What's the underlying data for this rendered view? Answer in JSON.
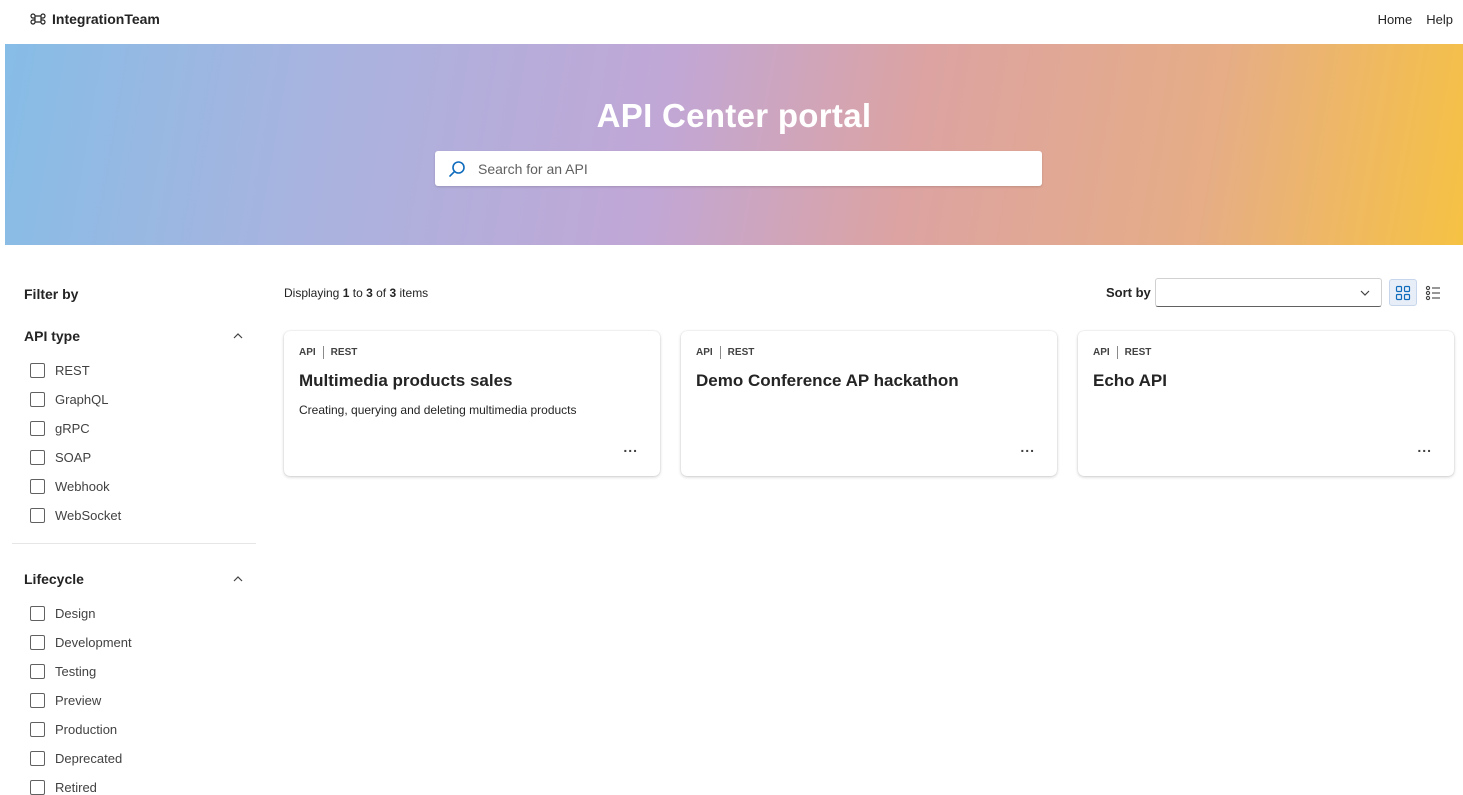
{
  "nav": {
    "brand": "IntegrationTeam",
    "brand_icon": "command-key-icon",
    "links": [
      "Home",
      "Help"
    ]
  },
  "hero": {
    "title": "API Center portal",
    "search_placeholder": "Search for an API",
    "search_icon": "search-icon",
    "gradient_colors": [
      "#86bde6",
      "#c1a7d6",
      "#dca3a2",
      "#f6c243"
    ]
  },
  "filters": {
    "title": "Filter by",
    "api_type": {
      "label": "API type",
      "options": [
        "REST",
        "GraphQL",
        "gRPC",
        "SOAP",
        "Webhook",
        "WebSocket"
      ]
    },
    "lifecycle": {
      "label": "Lifecycle",
      "options": [
        "Design",
        "Development",
        "Testing",
        "Preview",
        "Production",
        "Deprecated",
        "Retired"
      ]
    }
  },
  "results": {
    "prefix": "Displaying",
    "from": "1",
    "to_word": "to",
    "to": "3",
    "of_word": "of",
    "total": "3",
    "suffix": "items"
  },
  "sort": {
    "label": "Sort by",
    "value": ""
  },
  "cards": [
    {
      "kind": "API",
      "type": "REST",
      "title": "Multimedia products sales",
      "description": "Creating, querying and deleting multimedia products",
      "more": "..."
    },
    {
      "kind": "API",
      "type": "REST",
      "title": "Demo Conference AP hackathon",
      "description": "",
      "more": "..."
    },
    {
      "kind": "API",
      "type": "REST",
      "title": "Echo API",
      "description": "",
      "more": "..."
    }
  ],
  "colors": {
    "accent": "#0f6cbd",
    "text": "#242424"
  }
}
